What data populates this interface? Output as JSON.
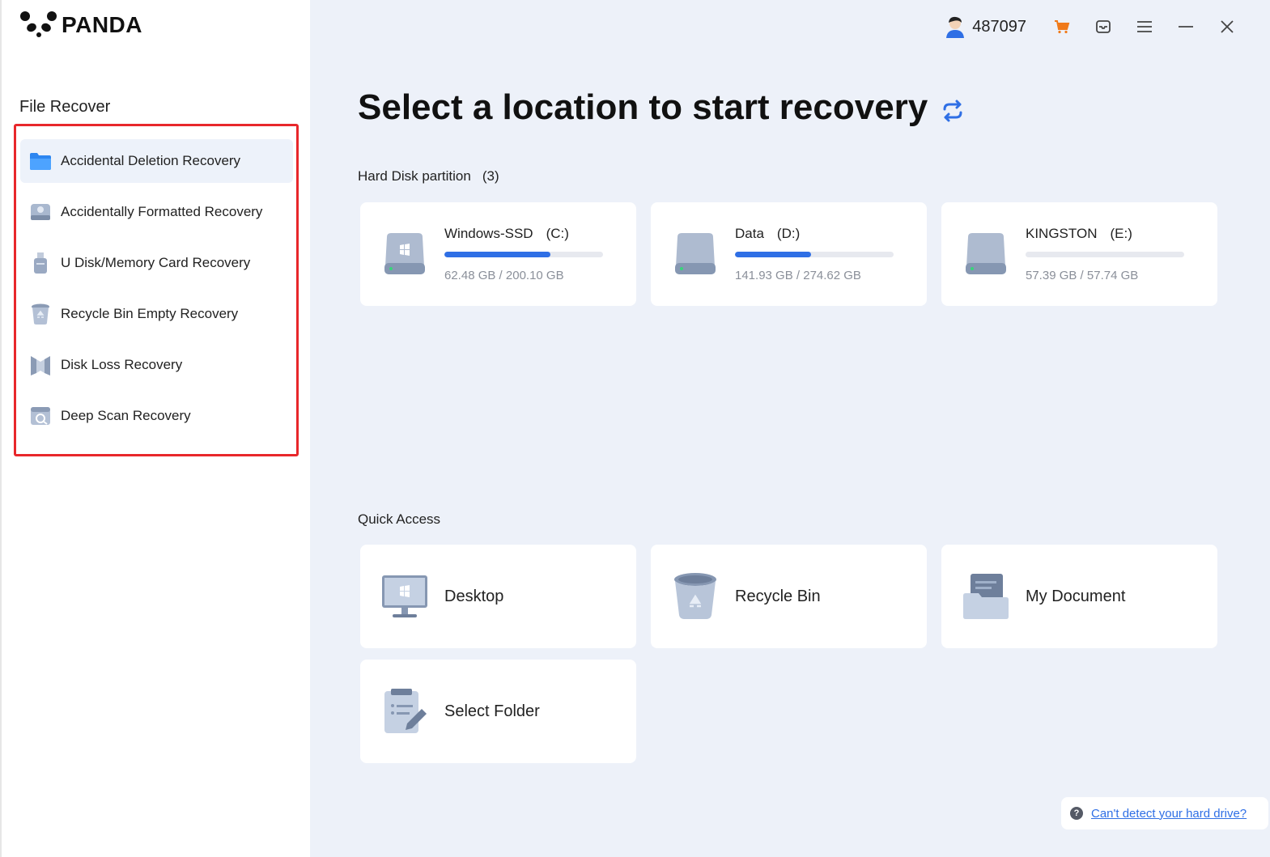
{
  "app": {
    "logo_text": "PANDA"
  },
  "sidebar": {
    "section_title": "File Recover",
    "items": [
      {
        "label": "Accidental Deletion Recovery",
        "icon": "folder-icon",
        "active": true
      },
      {
        "label": "Accidentally Formatted Recovery",
        "icon": "formatted-disk-icon"
      },
      {
        "label": "U Disk/Memory Card Recovery",
        "icon": "usb-drive-icon"
      },
      {
        "label": "Recycle Bin Empty Recovery",
        "icon": "recycle-bin-icon"
      },
      {
        "label": "Disk Loss Recovery",
        "icon": "disk-loss-icon"
      },
      {
        "label": "Deep Scan Recovery",
        "icon": "deep-scan-icon"
      }
    ]
  },
  "topbar": {
    "user_id": "487097"
  },
  "main": {
    "title": "Select a location to start recovery",
    "partition_label": "Hard Disk partition",
    "partition_count": "(3)",
    "drives": [
      {
        "name": "Windows-SSD",
        "letter": "(C:)",
        "size": "62.48 GB / 200.10 GB",
        "used_fraction": 0.67
      },
      {
        "name": "Data",
        "letter": "(D:)",
        "size": "141.93 GB / 274.62 GB",
        "used_fraction": 0.48
      },
      {
        "name": "KINGSTON",
        "letter": "(E:)",
        "size": "57.39 GB / 57.74 GB",
        "used_fraction": 0.0
      }
    ],
    "quick_access_label": "Quick Access",
    "quick_access": [
      {
        "label": "Desktop",
        "icon": "desktop-monitor-icon"
      },
      {
        "label": "Recycle Bin",
        "icon": "recycle-bin-icon"
      },
      {
        "label": "My Document",
        "icon": "document-folder-icon"
      },
      {
        "label": "Select Folder",
        "icon": "clipboard-edit-icon"
      }
    ],
    "help_link": "Can't detect your hard drive?"
  },
  "colors": {
    "accent": "#2f6fe5",
    "highlight_border": "#e8272b",
    "background": "#edf1f9"
  }
}
